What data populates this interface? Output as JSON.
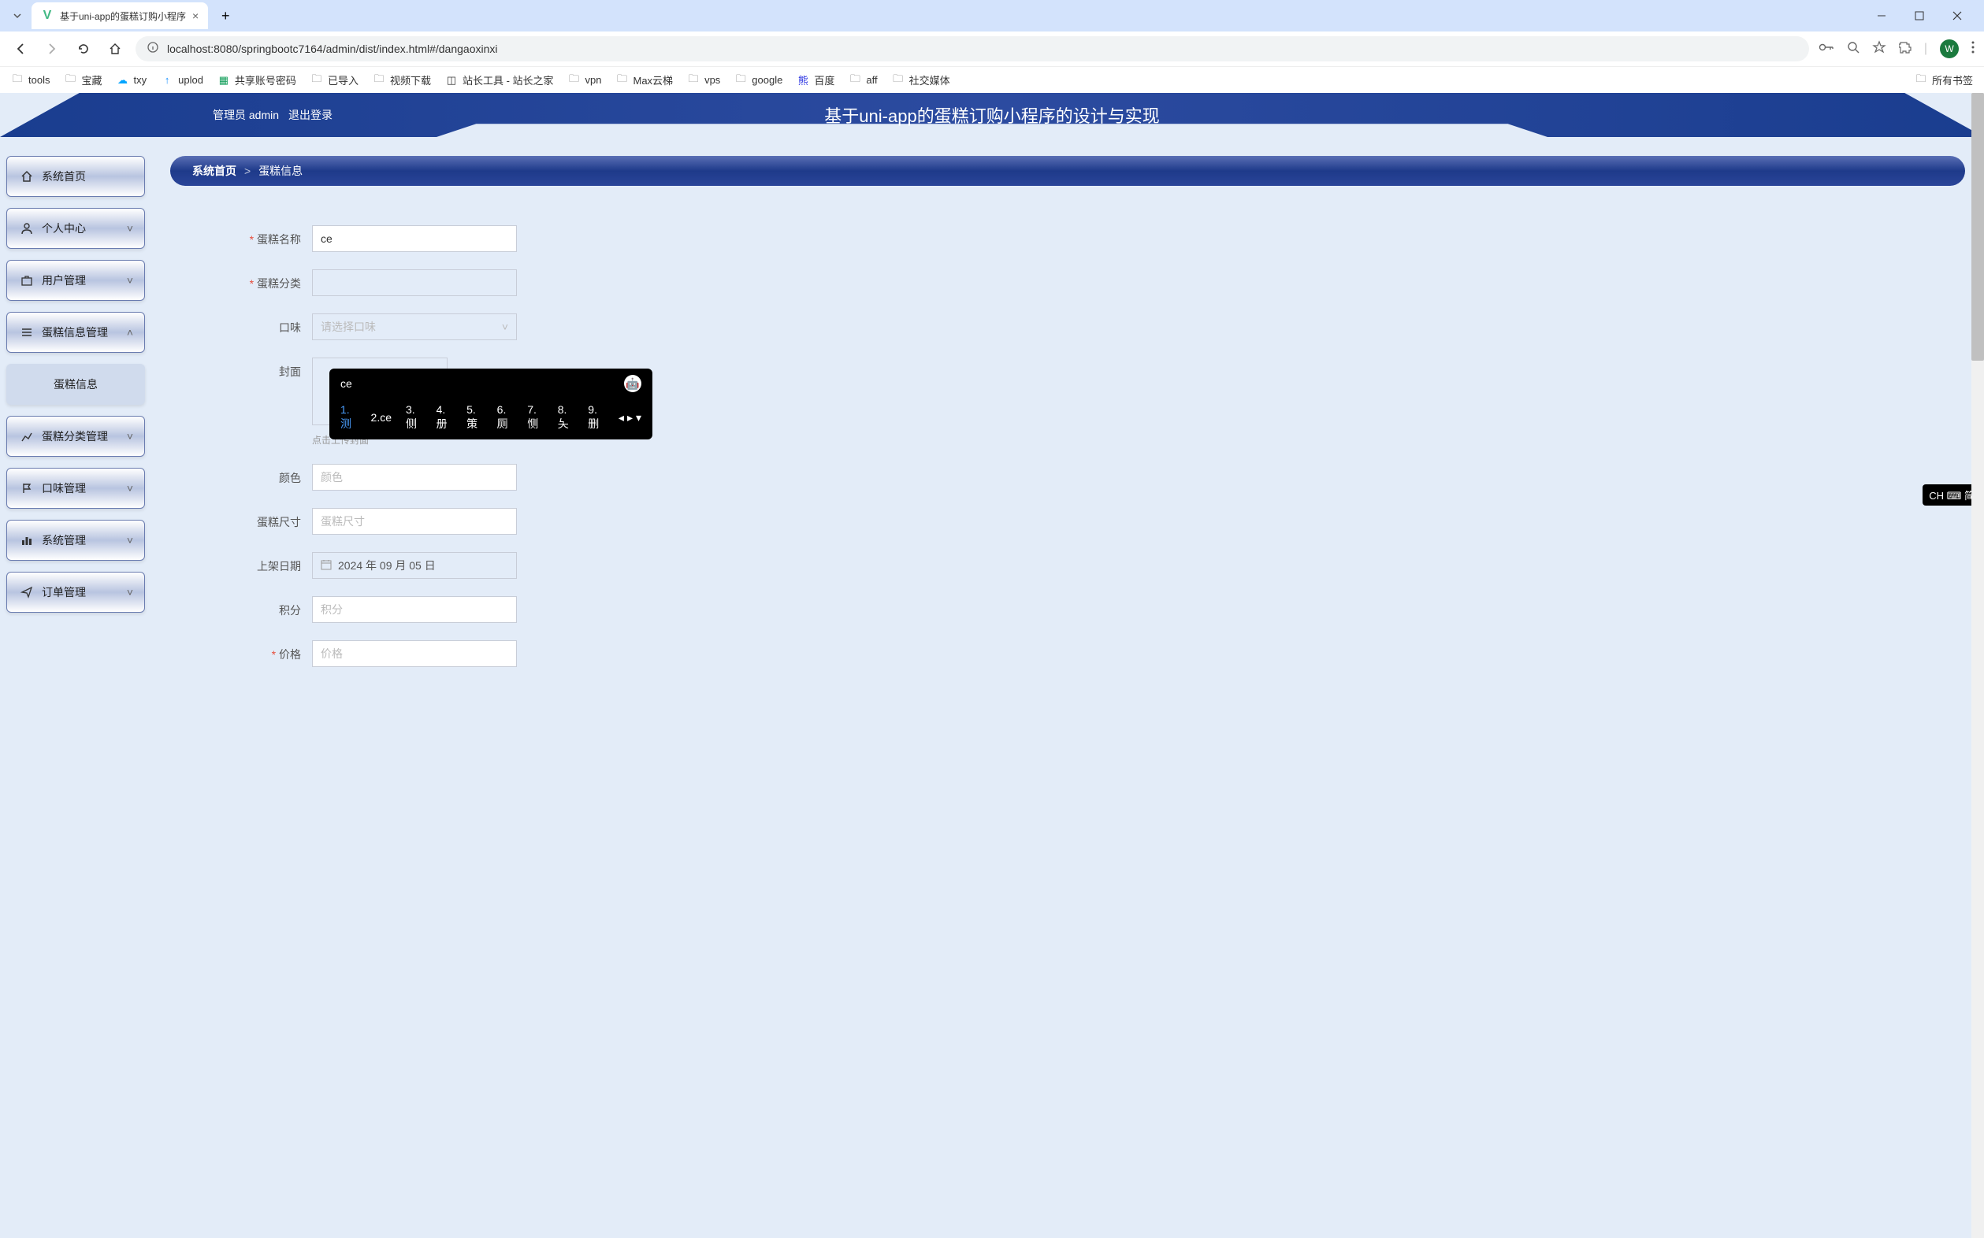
{
  "browser": {
    "tab_title": "基于uni-app的蛋糕订购小程序",
    "url": "localhost:8080/springbootc7164/admin/dist/index.html#/dangaoxinxi",
    "profile_letter": "W"
  },
  "bookmarks": [
    {
      "label": "tools",
      "type": "folder"
    },
    {
      "label": "宝藏",
      "type": "folder"
    },
    {
      "label": "txy",
      "type": "cloud"
    },
    {
      "label": "uplod",
      "type": "upload"
    },
    {
      "label": "共享账号密码",
      "type": "sheet"
    },
    {
      "label": "已导入",
      "type": "folder"
    },
    {
      "label": "视频下载",
      "type": "folder"
    },
    {
      "label": "站长工具 - 站长之家",
      "type": "icon"
    },
    {
      "label": "vpn",
      "type": "folder"
    },
    {
      "label": "Max云梯",
      "type": "folder"
    },
    {
      "label": "vps",
      "type": "folder"
    },
    {
      "label": "google",
      "type": "folder"
    },
    {
      "label": "百度",
      "type": "baidu"
    },
    {
      "label": "aff",
      "type": "folder"
    },
    {
      "label": "社交媒体",
      "type": "folder"
    }
  ],
  "all_bookmarks_label": "所有书签",
  "header": {
    "admin_label": "管理员 admin",
    "logout_label": "退出登录",
    "title": "基于uni-app的蛋糕订购小程序的设计与实现"
  },
  "sidebar": [
    {
      "label": "系统首页",
      "icon": "home",
      "chevron": false
    },
    {
      "label": "个人中心",
      "icon": "person",
      "chevron": true
    },
    {
      "label": "用户管理",
      "icon": "briefcase",
      "chevron": true
    },
    {
      "label": "蛋糕信息管理",
      "icon": "list",
      "chevron": true,
      "expanded": true
    },
    {
      "label": "蛋糕信息",
      "sub": true
    },
    {
      "label": "蛋糕分类管理",
      "icon": "chart",
      "chevron": true
    },
    {
      "label": "口味管理",
      "icon": "flag",
      "chevron": true
    },
    {
      "label": "系统管理",
      "icon": "bars",
      "chevron": true
    },
    {
      "label": "订单管理",
      "icon": "send",
      "chevron": true
    }
  ],
  "breadcrumb": {
    "home": "系统首页",
    "sep": ">",
    "current": "蛋糕信息"
  },
  "form": {
    "cake_name": {
      "label": "蛋糕名称",
      "value": "ce",
      "required": true
    },
    "cake_category": {
      "label": "蛋糕分类",
      "placeholder": "",
      "required": true
    },
    "flavor": {
      "label": "口味",
      "placeholder": "请选择口味"
    },
    "cover": {
      "label": "封面",
      "hint": "点击上传封面"
    },
    "color": {
      "label": "颜色",
      "placeholder": "颜色"
    },
    "size": {
      "label": "蛋糕尺寸",
      "placeholder": "蛋糕尺寸"
    },
    "date": {
      "label": "上架日期",
      "value": "2024 年 09 月 05 日"
    },
    "points": {
      "label": "积分",
      "placeholder": "积分"
    },
    "price": {
      "label": "价格",
      "placeholder": "价格",
      "required": true
    }
  },
  "ime": {
    "input": "ce",
    "candidates": [
      "1.测",
      "2.ce",
      "3.侧",
      "4.册",
      "5.策",
      "6.厕",
      "7.恻",
      "8.夨",
      "9.删"
    ],
    "badge": "CH ⌨ 简"
  }
}
